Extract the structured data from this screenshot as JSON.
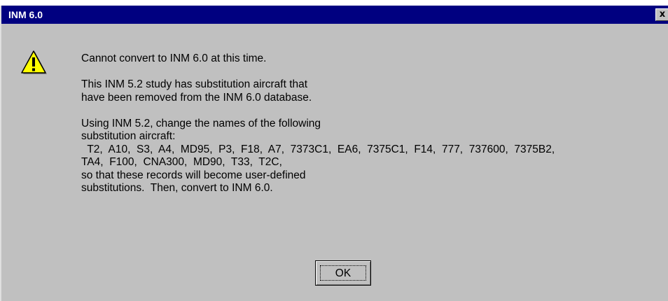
{
  "window": {
    "title": "INM 6.0",
    "close_glyph": "x",
    "icon": "warning-icon"
  },
  "message": {
    "line1": "Cannot convert to INM 6.0 at this time.",
    "line2": "This INM 5.2 study has substitution aircraft that",
    "line3": "have been removed from the INM 6.0 database.",
    "line4": "Using INM 5.2, change the names of the following",
    "line5": "substitution aircraft:",
    "line6": "  T2,  A10,  S3,  A4,  MD95,  P3,  F18,  A7,  7373C1,  EA6,  7375C1,  F14,  777,  737600,  7375B2,",
    "line7": "TA4,  F100,  CNA300,  MD90,  T33,  T2C,",
    "line8": "so that these records will become user-defined",
    "line9": "substitutions.  Then, convert to INM 6.0."
  },
  "buttons": {
    "ok_label": "OK"
  },
  "colors": {
    "titlebar": "#000080",
    "dialog_face": "#c0c0c0",
    "icon_yellow": "#ffff00"
  }
}
